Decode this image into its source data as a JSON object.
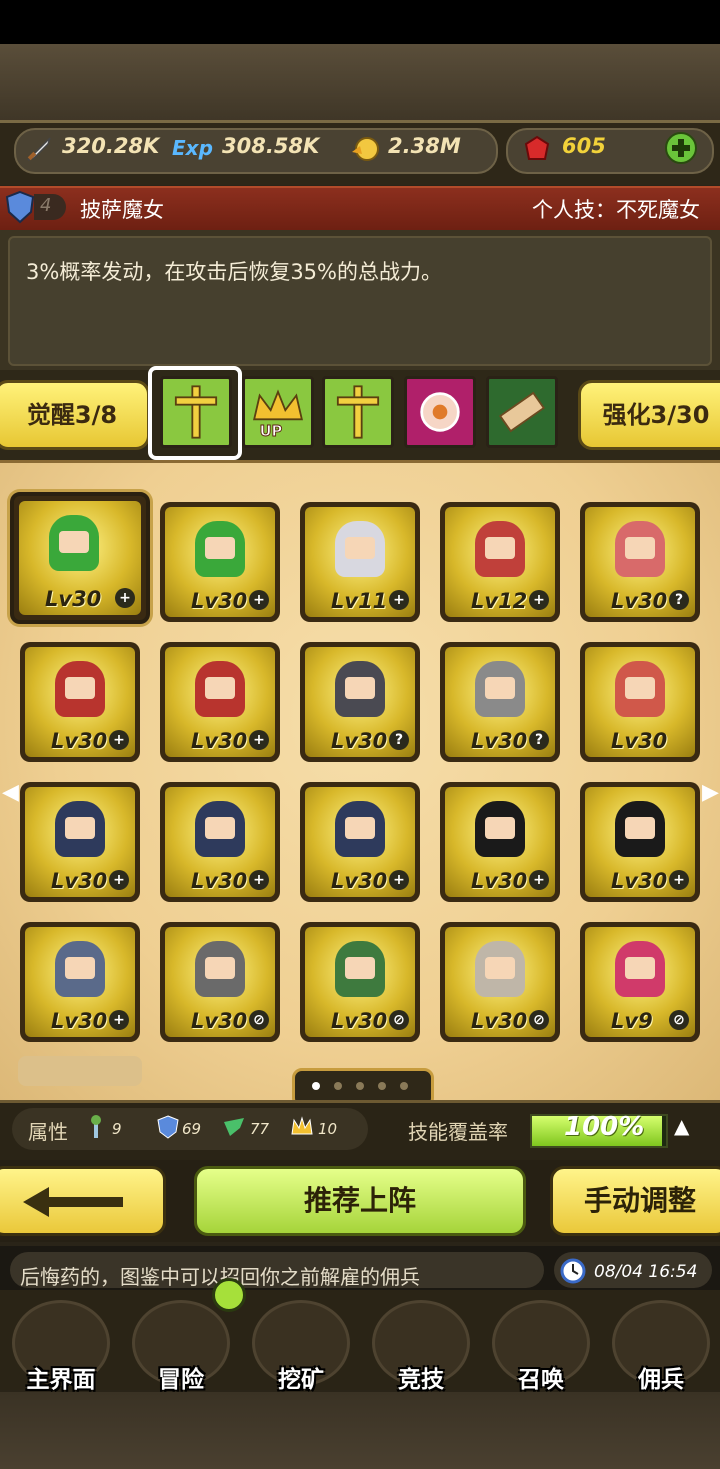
{
  "resources": {
    "attack": "320.28K",
    "exp": "308.58K",
    "gold": "2.38M",
    "gems": "605",
    "exp_icon_text": "Exp"
  },
  "skill": {
    "level": "4",
    "name": "披萨魔女",
    "personal_skill": "个人技：不死魔女",
    "description": "3%概率发动，在攻击后恢复35%的总战力。"
  },
  "awaken": {
    "awaken_label": "觉醒3/8",
    "enhance_label": "强化3/30",
    "up_text": "UP"
  },
  "heroes": [
    {
      "lv": "Lv30",
      "badge": "+",
      "color": "#3aa83a"
    },
    {
      "lv": "Lv30",
      "badge": "+",
      "color": "#3aa83a"
    },
    {
      "lv": "Lv11",
      "badge": "+",
      "color": "#d8d8e0"
    },
    {
      "lv": "Lv12",
      "badge": "+",
      "color": "#c0403a"
    },
    {
      "lv": "Lv30",
      "badge": "?",
      "color": "#d86a6a"
    },
    {
      "lv": "Lv30",
      "badge": "+",
      "color": "#b8342e"
    },
    {
      "lv": "Lv30",
      "badge": "+",
      "color": "#b8342e"
    },
    {
      "lv": "Lv30",
      "badge": "?",
      "color": "#4a4a52"
    },
    {
      "lv": "Lv30",
      "badge": "?",
      "color": "#8a8a8a"
    },
    {
      "lv": "Lv30",
      "badge": "",
      "color": "#d0584a"
    },
    {
      "lv": "Lv30",
      "badge": "+",
      "color": "#2e3a5c"
    },
    {
      "lv": "Lv30",
      "badge": "+",
      "color": "#2e3a5c"
    },
    {
      "lv": "Lv30",
      "badge": "+",
      "color": "#2e3a5c"
    },
    {
      "lv": "Lv30",
      "badge": "+",
      "color": "#1a1a1a"
    },
    {
      "lv": "Lv30",
      "badge": "+",
      "color": "#1a1a1a"
    },
    {
      "lv": "Lv30",
      "badge": "+",
      "color": "#5a6a8a"
    },
    {
      "lv": "Lv30",
      "badge": "⊘",
      "color": "#6a6a6a"
    },
    {
      "lv": "Lv30",
      "badge": "⊘",
      "color": "#3e7a3e"
    },
    {
      "lv": "Lv30",
      "badge": "⊘",
      "color": "#bfb6a8"
    },
    {
      "lv": "Lv9",
      "badge": "⊘",
      "color": "#d03a6a"
    }
  ],
  "attributes": {
    "label": "属性",
    "nature": "9",
    "defense": "69",
    "speed": "77",
    "crown": "10",
    "coverage_label": "技能覆盖率",
    "coverage_value": "100%",
    "coverage_fraction": 1.0
  },
  "buttons": {
    "recommend": "推荐上阵",
    "manual": "手动调整"
  },
  "ticker": {
    "message": "后悔药的，图鉴中可以招回你之前解雇的佣兵",
    "time": "08/04 16:54"
  },
  "nav": [
    {
      "label": "主界面",
      "icon": "map-scroll-icon"
    },
    {
      "label": "冒险",
      "icon": "island-icon"
    },
    {
      "label": "挖矿",
      "icon": "pickaxe-icon"
    },
    {
      "label": "竞技",
      "icon": "crossed-swords-icon"
    },
    {
      "label": "召唤",
      "icon": "summon-scroll-icon"
    },
    {
      "label": "佣兵",
      "icon": "tent-icon"
    }
  ],
  "colors": {
    "accent_yellow": "#f2e04a",
    "accent_green": "#b8e04a",
    "skill_header_red": "#8c2f1e"
  }
}
